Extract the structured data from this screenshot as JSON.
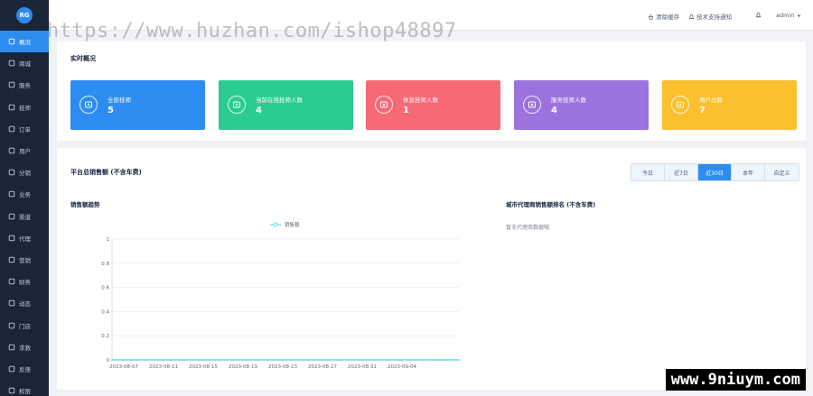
{
  "header": {
    "clear_cache": "清除缓存",
    "tech_notice": "技术支持通知",
    "user": "admin"
  },
  "sidebar": {
    "logo_text": "RG",
    "items": [
      {
        "label": "概况",
        "icon": "home-icon",
        "active": true
      },
      {
        "label": "商城",
        "icon": "shop-icon"
      },
      {
        "label": "服务",
        "icon": "service-icon"
      },
      {
        "label": "技师",
        "icon": "technician-icon"
      },
      {
        "label": "订单",
        "icon": "order-icon"
      },
      {
        "label": "用户",
        "icon": "user-icon"
      },
      {
        "label": "分销",
        "icon": "distribution-icon"
      },
      {
        "label": "业务",
        "icon": "business-icon"
      },
      {
        "label": "渠道",
        "icon": "channel-icon"
      },
      {
        "label": "代理",
        "icon": "agent-icon"
      },
      {
        "label": "营销",
        "icon": "marketing-icon"
      },
      {
        "label": "财务",
        "icon": "finance-icon"
      },
      {
        "label": "动态",
        "icon": "dynamic-icon"
      },
      {
        "label": "门店",
        "icon": "store-icon"
      },
      {
        "label": "求救",
        "icon": "sos-icon"
      },
      {
        "label": "反馈",
        "icon": "feedback-icon"
      },
      {
        "label": "权限",
        "icon": "permission-icon"
      }
    ]
  },
  "overview": {
    "title": "实时概况",
    "cards": [
      {
        "label": "全部技师",
        "value": "5",
        "color": "#2d8cf0",
        "icon": "technician-icon"
      },
      {
        "label": "当前在线技师人数",
        "value": "4",
        "color": "#2bcc8f",
        "icon": "online-icon"
      },
      {
        "label": "休息技师人数",
        "value": "1",
        "color": "#f56a75",
        "icon": "rest-icon"
      },
      {
        "label": "服务技师人数",
        "value": "4",
        "color": "#9b72de",
        "icon": "service-icon"
      },
      {
        "label": "用户总数",
        "value": "7",
        "color": "#fbc02d",
        "icon": "users-icon"
      }
    ]
  },
  "sales": {
    "title": "平台总销售额 (不含车费)",
    "ranges": [
      "今日",
      "近7日",
      "近30日",
      "本年",
      "自定义"
    ],
    "active_range": 2,
    "trend_title": "销售额趋势",
    "ranking_title": "城市代理商销售额排名 (不含车费)",
    "ranking_empty": "暂无代理商数据哦"
  },
  "watermarks": {
    "top": "https://www.huzhan.com/ishop48897",
    "bottom": "www.9niuym.com"
  },
  "chart_data": {
    "type": "line",
    "series": [
      {
        "name": "销售额",
        "color": "#4fd1e8",
        "values": [
          0,
          0,
          0,
          0,
          0,
          0,
          0,
          0,
          0,
          0,
          0,
          0,
          0,
          0,
          0,
          0,
          0,
          0,
          0,
          0,
          0,
          0,
          0,
          0,
          0,
          0,
          0,
          0,
          0,
          0
        ]
      }
    ],
    "x_tick_labels": [
      "2023-08-07",
      "2023-08-11",
      "2023-08-15",
      "2023-08-19",
      "2023-08-23",
      "2023-08-27",
      "2023-08-31",
      "2023-09-04"
    ],
    "y_tick_labels": [
      "0",
      "0.2",
      "0.4",
      "0.6",
      "0.8",
      "1"
    ],
    "ylim": [
      0,
      1
    ],
    "grid": true,
    "legend": "top"
  }
}
